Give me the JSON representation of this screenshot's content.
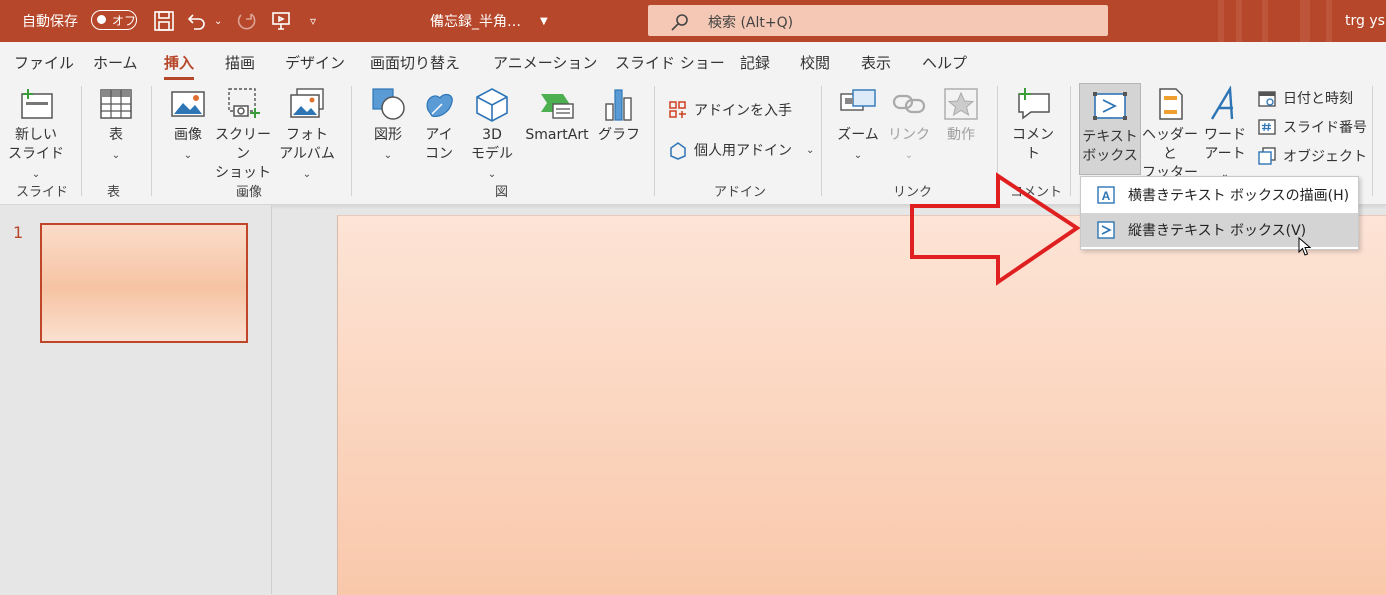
{
  "titlebar": {
    "autosave_label": "自動保存",
    "autosave_state": "オフ",
    "document_title": "備忘録_半角…",
    "search_placeholder": "検索 (Alt+Q)",
    "user": "trg ys"
  },
  "tabs": [
    "ファイル",
    "ホーム",
    "挿入",
    "描画",
    "デザイン",
    "画面切り替え",
    "アニメーション",
    "スライド ショー",
    "記録",
    "校閲",
    "表示",
    "ヘルプ"
  ],
  "active_tab": "挿入",
  "ribbon": {
    "new_slide": [
      "新しい",
      "スライド"
    ],
    "table": "表",
    "image": "画像",
    "screenshot": [
      "スクリーン",
      "ショット"
    ],
    "photo_album": [
      "フォト",
      "アルバム"
    ],
    "shapes": "図形",
    "icons": [
      "アイ",
      "コン"
    ],
    "model3d": [
      "3D",
      "モデル"
    ],
    "smartart": "SmartArt",
    "chart": "グラフ",
    "get_addins": "アドインを入手",
    "my_addins": "個人用アドイン",
    "zoom": "ズーム",
    "link": "リンク",
    "action": "動作",
    "comment": "コメント",
    "textbox": [
      "テキスト",
      "ボックス"
    ],
    "header_footer": [
      "ヘッダーと",
      "フッター"
    ],
    "wordart": [
      "ワード",
      "アート"
    ],
    "date_time": "日付と時刻",
    "slide_number": "スライド番号",
    "object": "オブジェクト",
    "groups": {
      "slides": "スライド",
      "tables": "表",
      "images": "画像",
      "illustrations": "図",
      "addins": "アドイン",
      "links": "リンク",
      "comments": "コメント"
    }
  },
  "dropdown": {
    "items": [
      "横書きテキスト ボックスの描画(H)",
      "縦書きテキスト ボックス(V)"
    ],
    "highlighted_index": 1
  },
  "slides_pane": {
    "slide_number": "1"
  },
  "colors": {
    "accent": "#b7472a",
    "arrow": "#e02020",
    "canvas_top": "#fde4d6",
    "canvas_bottom": "#f9c8ab"
  }
}
